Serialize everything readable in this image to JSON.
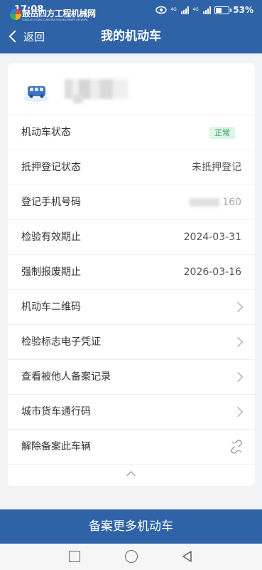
{
  "status_bar": {
    "time": "17:08",
    "battery_text": "53%",
    "battery_level": 0.53,
    "signal_labels": [
      "4G",
      "4G"
    ]
  },
  "watermark": {
    "title": "鼓岳四方工程机械网",
    "subtitle": "TONGLUE SI FANG CONSTRUCTION MACHINERY NETWORK"
  },
  "header": {
    "back_label": "返回",
    "title": "我的机动车"
  },
  "vehicle": {
    "icon": "bus-icon"
  },
  "rows": [
    {
      "label": "机动车状态",
      "badge": "正常"
    },
    {
      "label": "抵押登记状态",
      "value": "未抵押登记"
    },
    {
      "label": "登记手机号码",
      "value": "160"
    },
    {
      "label": "检验有效期止",
      "value": "2024-03-31"
    },
    {
      "label": "强制报废期止",
      "value": "2026-03-16"
    },
    {
      "label": "机动车二维码"
    },
    {
      "label": "检验标志电子凭证"
    },
    {
      "label": "查看被他人备案记录"
    },
    {
      "label": "城市货车通行码"
    },
    {
      "label": "解除备案此车辆"
    }
  ],
  "primary_button": {
    "label": "备案更多机动车"
  },
  "colors": {
    "brand": "#2f63a8",
    "badge_bg": "#ddf5e7",
    "badge_text": "#2fa35e",
    "background": "#f2f3f5"
  },
  "icons": {
    "back": "chevron-left-icon",
    "row_arrow": "chevron-right-icon",
    "unlink": "unlink-icon",
    "collapse": "chevron-up-icon",
    "nav_recents": "square-icon",
    "nav_home": "circle-icon",
    "nav_back": "triangle-back-icon"
  }
}
